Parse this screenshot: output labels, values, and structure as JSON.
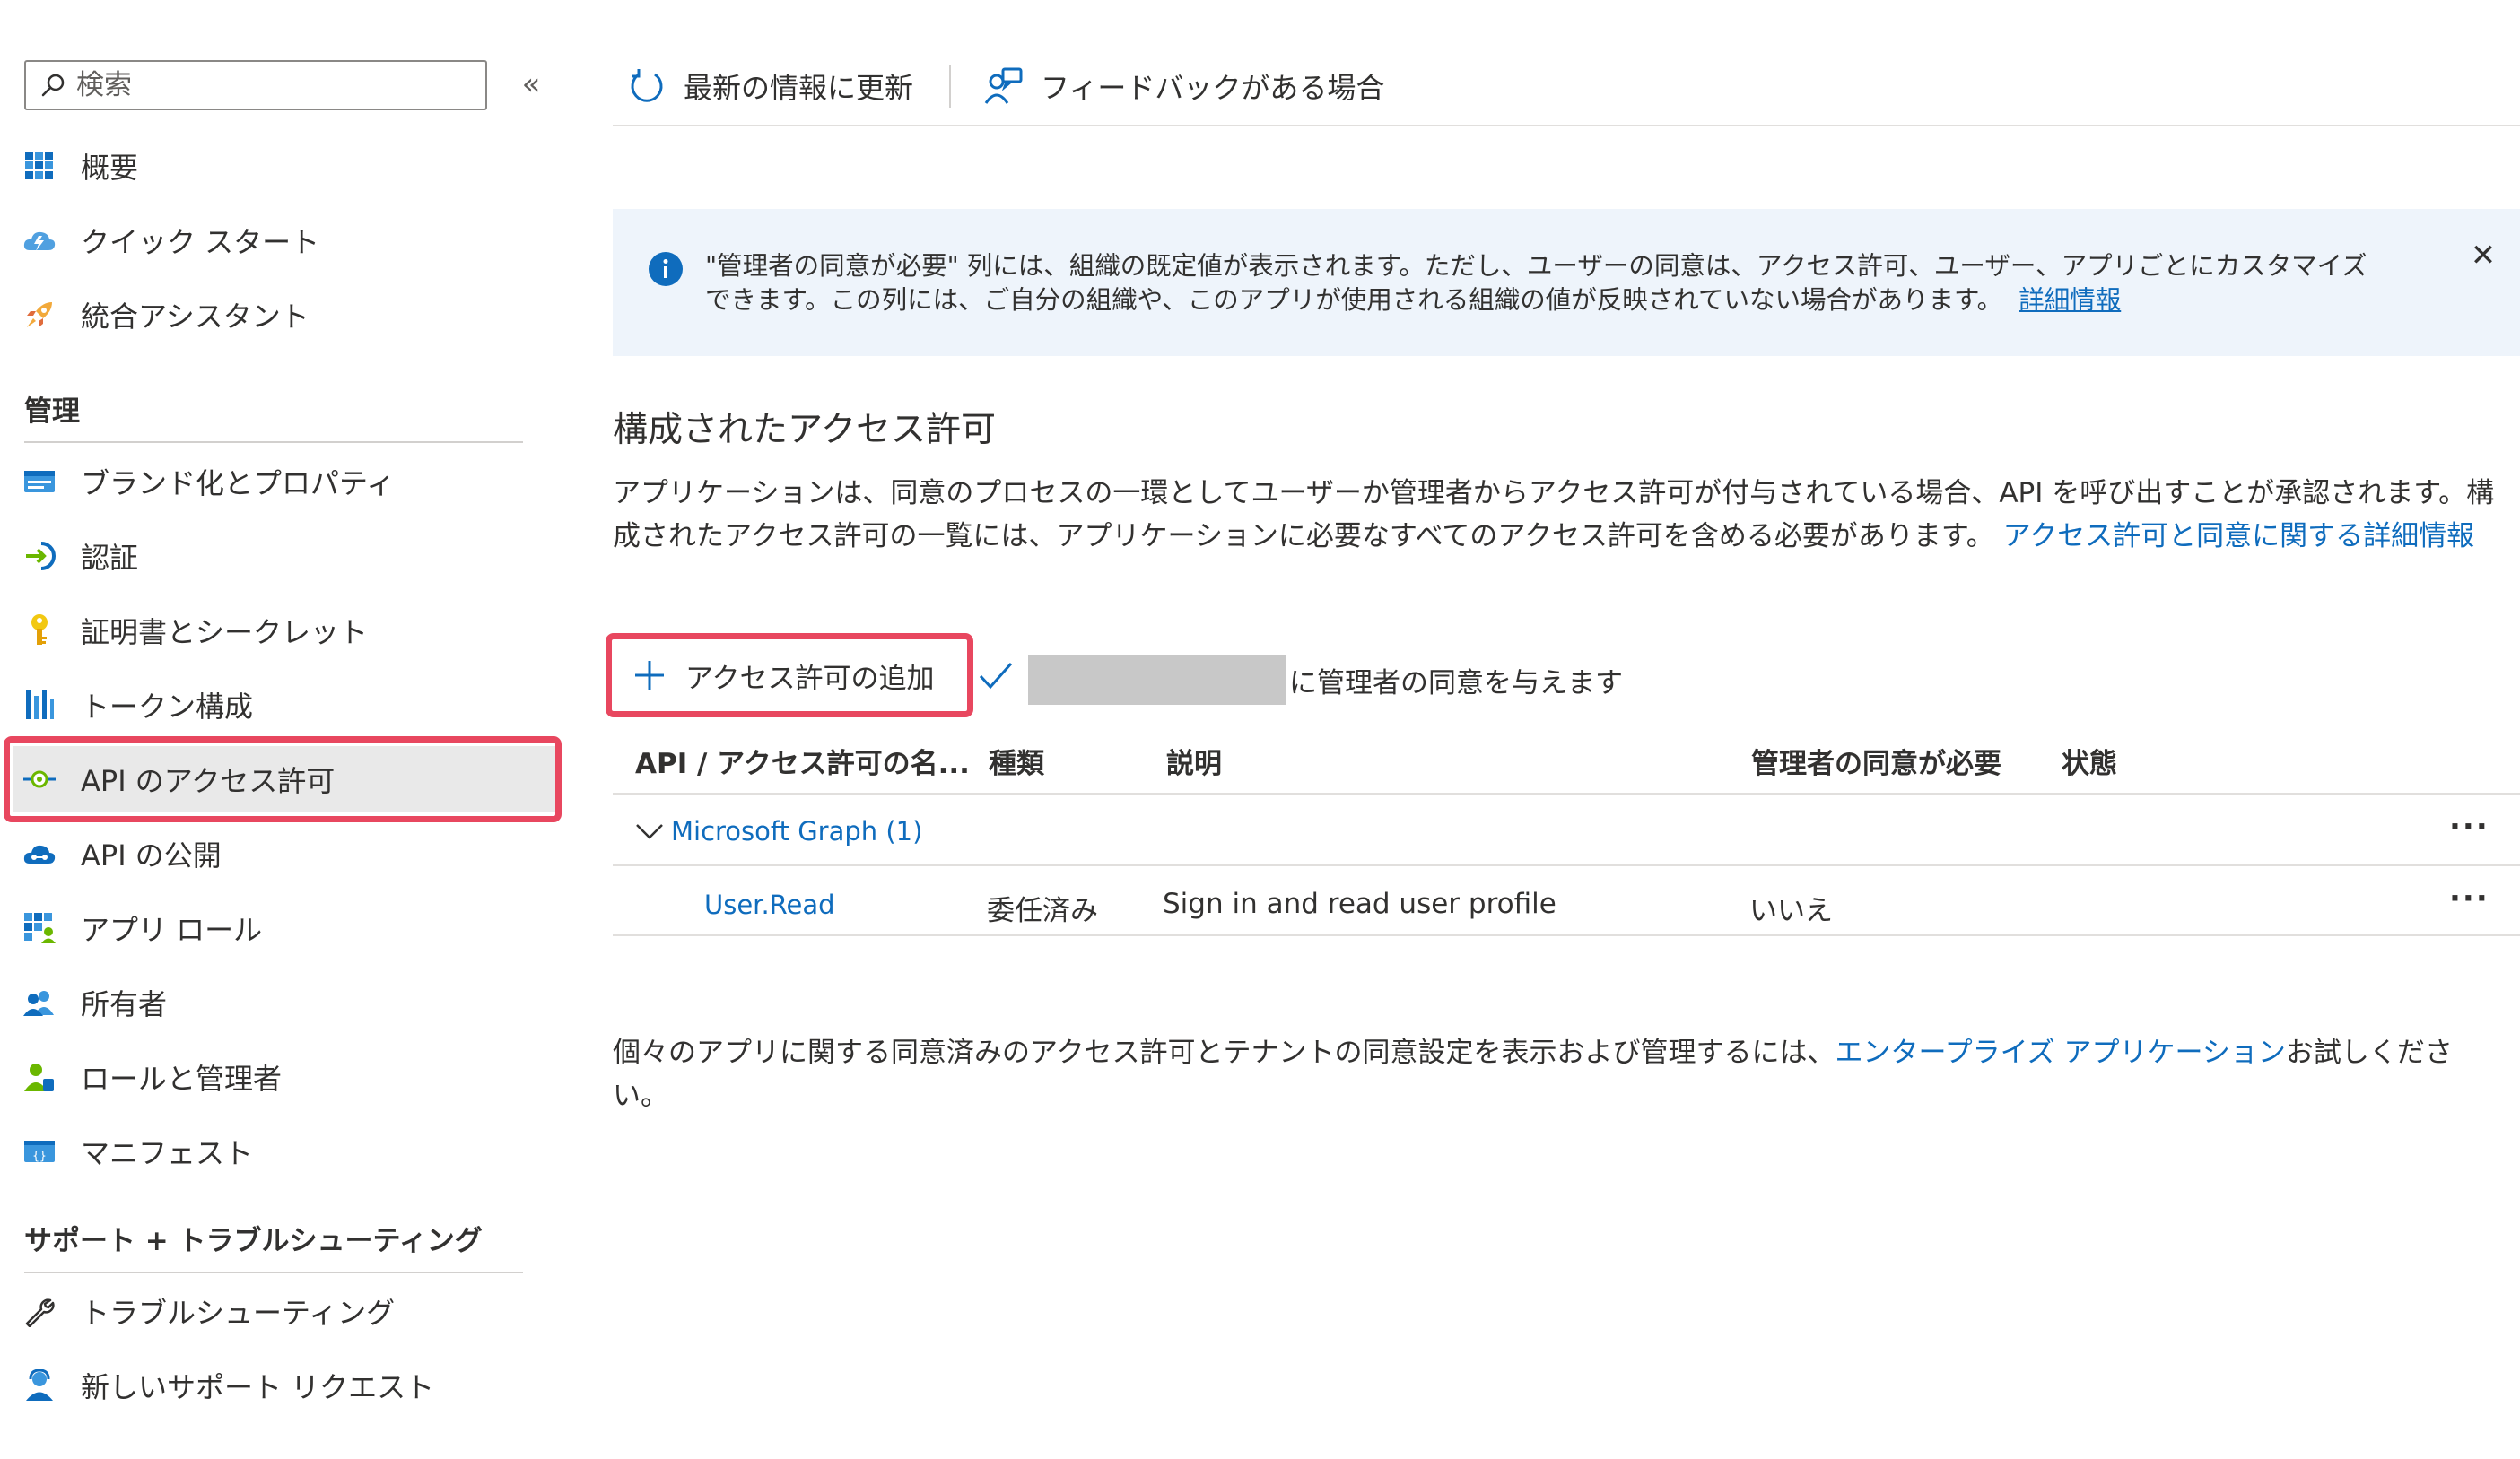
{
  "sidebar": {
    "search_placeholder": "検索",
    "collapse_label": "«",
    "items_top": [
      {
        "label": "概要",
        "icon": "overview-grid-icon"
      },
      {
        "label": "クイック スタート",
        "icon": "cloud-lightning-icon"
      },
      {
        "label": "統合アシスタント",
        "icon": "rocket-icon"
      }
    ],
    "section_manage": "管理",
    "items_manage": [
      {
        "label": "ブランド化とプロパティ",
        "icon": "branding-card-icon"
      },
      {
        "label": "認証",
        "icon": "authentication-arrow-icon"
      },
      {
        "label": "証明書とシークレット",
        "icon": "key-icon"
      },
      {
        "label": "トークン構成",
        "icon": "token-bars-icon"
      },
      {
        "label": "API のアクセス許可",
        "icon": "api-permission-icon",
        "active": true
      },
      {
        "label": "API の公開",
        "icon": "cloud-api-icon"
      },
      {
        "label": "アプリ ロール",
        "icon": "app-roles-grid-icon"
      },
      {
        "label": "所有者",
        "icon": "owners-people-icon"
      },
      {
        "label": "ロールと管理者",
        "icon": "roles-admin-icon"
      },
      {
        "label": "マニフェスト",
        "icon": "manifest-code-icon"
      }
    ],
    "section_support": "サポート + トラブルシューティング",
    "items_support": [
      {
        "label": "トラブルシューティング",
        "icon": "wrench-icon"
      },
      {
        "label": "新しいサポート リクエスト",
        "icon": "support-person-icon"
      }
    ]
  },
  "toolbar": {
    "refresh_label": "最新の情報に更新",
    "feedback_label": "フィードバックがある場合"
  },
  "banner": {
    "line1": "\"管理者の同意が必要\" 列には、組織の既定値が表示されます。ただし、ユーザーの同意は、アクセス許可、ユーザー、アプリごとにカスタマイズ",
    "line2": "できます。この列には、ご自分の組織や、このアプリが使用される組織の値が反映されていない場合があります。",
    "link": "詳細情報",
    "close": "✕"
  },
  "main": {
    "heading": "構成されたアクセス許可",
    "description": "アプリケーションは、同意のプロセスの一環としてユーザーか管理者からアクセス許可が付与されている場合、API を呼び出すことが承認されます。構成されたアクセス許可の一覧には、アプリケーションに必要なすべてのアクセス許可を含める必要があります。",
    "description_link": "アクセス許可と同意に関する詳細情報",
    "add_permission": "アクセス許可の追加",
    "grant_consent_suffix": "に管理者の同意を与えます"
  },
  "table": {
    "headers": [
      "API / アクセス許可の名...",
      "種類",
      "説明",
      "管理者の同意が必要",
      "状態"
    ],
    "group": "Microsoft Graph (1)",
    "rows": [
      {
        "name": "User.Read",
        "type": "委任済み",
        "description": "Sign in and read user profile",
        "admin_consent": "いいえ",
        "status": ""
      }
    ],
    "ellipsis": "···"
  },
  "footer": {
    "text_before": "個々のアプリに関する同意済みのアクセス許可とテナントの同意設定を表示および管理するには、",
    "link": "エンタープライズ アプリケーション",
    "text_after": "お試しください。"
  },
  "colors": {
    "accent": "#0f6cbd",
    "highlight": "#e8475f",
    "banner_bg": "#eef4fb",
    "active_bg": "#e9e9e9"
  }
}
